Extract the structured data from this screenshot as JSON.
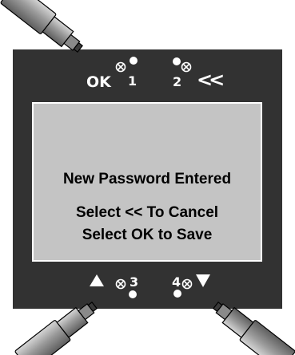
{
  "device": {
    "buttons": {
      "ok_label": "OK",
      "back_label": "<<",
      "button1_number": "1",
      "button2_number": "2",
      "button3_number": "3",
      "button4_number": "4"
    },
    "display": {
      "line1": "New Password Entered",
      "line2": "Select << To Cancel",
      "line3": "Select OK to Save"
    },
    "icons": {
      "up": "up-arrow-icon",
      "down": "down-arrow-icon",
      "indicator": "x-circle-indicator-icon",
      "led": "led-dot-icon",
      "pointer": "pointing-stylus-icon"
    },
    "colors": {
      "panel": "#323232",
      "display": "#c4c4c4",
      "label": "#ffffff",
      "stylus": "#8a8a8a"
    }
  }
}
